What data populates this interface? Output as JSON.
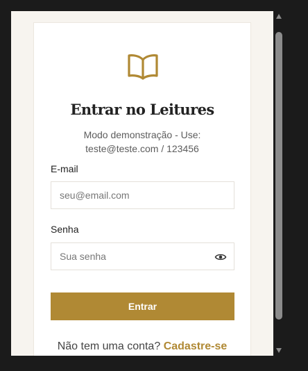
{
  "login": {
    "title": "Entrar no Leitures",
    "subtitle": "Modo demonstração - Use: teste@teste.com / 123456",
    "email": {
      "label": "E-mail",
      "placeholder": "seu@email.com",
      "value": ""
    },
    "password": {
      "label": "Senha",
      "placeholder": "Sua senha",
      "value": ""
    },
    "submit_label": "Entrar",
    "signup_prompt": "Não tem uma conta?",
    "signup_link": "Cadastre-se"
  },
  "icons": {
    "logo": "book-open-icon",
    "toggle_password": "eye-icon"
  },
  "colors": {
    "accent": "#b08934",
    "page_background": "#f7f4ef",
    "card": "#ffffff"
  }
}
